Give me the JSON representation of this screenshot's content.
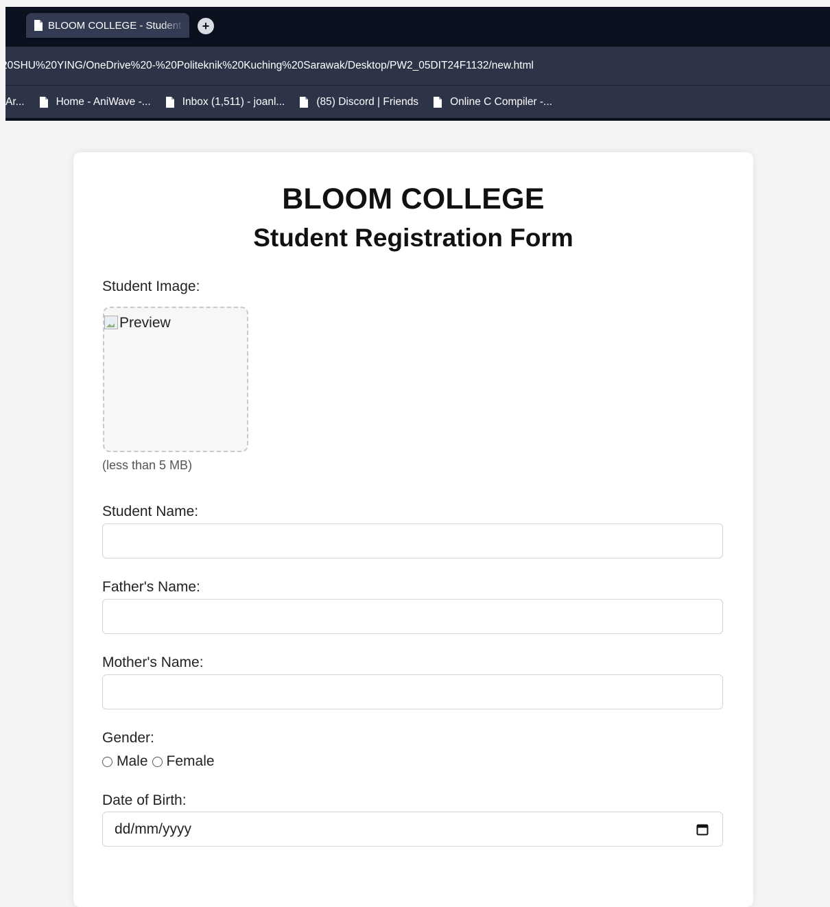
{
  "browser": {
    "tab_title": "BLOOM COLLEGE - Student Registration Form",
    "new_tab_symbol": "+",
    "address_url": "20SHU%20YING/OneDrive%20-%20Politeknik%20Kuching%20Sarawak/Desktop/PW2_05DIT24F1132/new.html",
    "bookmarks": [
      {
        "label": "Ar...",
        "icon": "none"
      },
      {
        "label": "Home - AniWave -...",
        "icon": "document-icon"
      },
      {
        "label": "Inbox (1,511) - joanl...",
        "icon": "document-icon"
      },
      {
        "label": "(85) Discord | Friends",
        "icon": "document-icon"
      },
      {
        "label": "Online C Compiler -...",
        "icon": "document-icon"
      }
    ]
  },
  "form": {
    "college_name": "BLOOM COLLEGE",
    "title": "Student Registration Form",
    "image_label": "Student Image:",
    "image_alt": "Preview",
    "image_hint": "(less than 5 MB)",
    "student_name_label": "Student Name:",
    "student_name_value": "",
    "father_name_label": "Father's Name:",
    "father_name_value": "",
    "mother_name_label": "Mother's Name:",
    "mother_name_value": "",
    "gender_label": "Gender:",
    "gender_options": [
      "Male",
      "Female"
    ],
    "dob_label": "Date of Birth:",
    "dob_placeholder": "dd/mm/yyyy"
  },
  "colors": {
    "tabstrip": "#0c1120",
    "toolbar": "#2d3448",
    "page_background": "#f4f4f4",
    "card": "#ffffff"
  }
}
